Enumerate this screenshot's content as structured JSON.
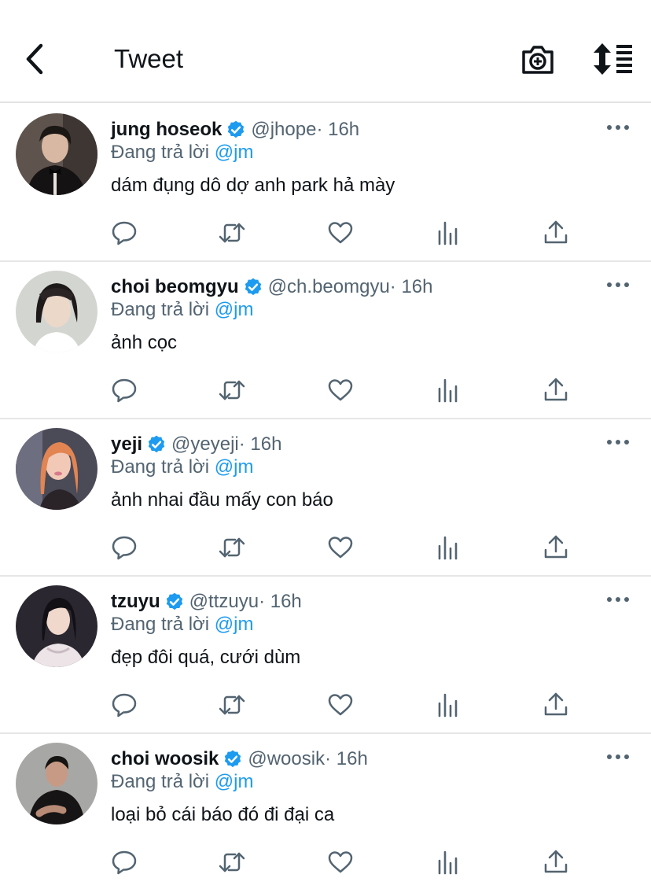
{
  "header": {
    "title": "Tweet",
    "back_icon": "chevron-left-icon",
    "camera_icon": "camera-plus-icon",
    "sort_icon": "sort-list-icon"
  },
  "colors": {
    "text": "#0f1419",
    "muted": "#536471",
    "link": "#1d9bf0",
    "verified": "#1d9bf0",
    "divider": "#e6e6e6"
  },
  "reply_prefix": "Đang trả lời",
  "tweets": [
    {
      "name": "jung hoseok",
      "handle": "@jhope",
      "time": "· 16h",
      "reply_to": "@jm",
      "text": "dám đụng dô dợ anh park hả mày"
    },
    {
      "name": "choi beomgyu",
      "handle": "@ch.beomgyu",
      "time": "· 16h",
      "reply_to": "@jm",
      "text": "ảnh cọc"
    },
    {
      "name": "yeji",
      "handle": "@yeyeji",
      "time": "· 16h",
      "reply_to": "@jm",
      "text": "ảnh nhai đầu mấy con báo"
    },
    {
      "name": "tzuyu",
      "handle": "@ttzuyu",
      "time": "· 16h",
      "reply_to": "@jm",
      "text": "đẹp đôi quá, cưới dùm"
    },
    {
      "name": "choi woosik",
      "handle": "@woosik",
      "time": "· 16h",
      "reply_to": "@jm",
      "text": "loại bỏ cái báo đó đi đại ca"
    }
  ]
}
